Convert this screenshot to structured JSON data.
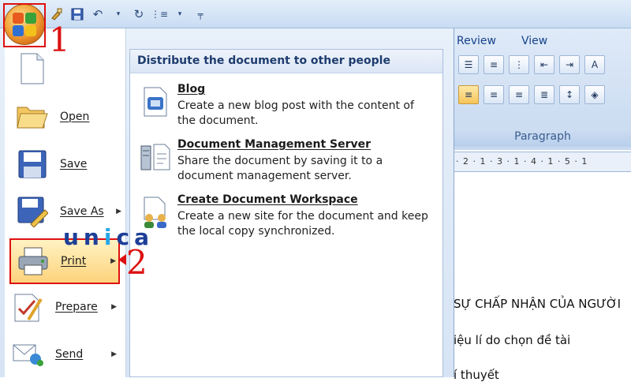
{
  "ribbon": {
    "tabs": [
      "Review",
      "View"
    ],
    "group_label": "Paragraph",
    "ruler_text": "· 2 · 1 · 3 · 1 · 4 · 1 · 5 · 1"
  },
  "document": {
    "lines": [
      "SỰ CHẤP NHẬN CỦA NGƯỜI",
      "iệu lí do chọn đề tài",
      "í thuyết"
    ]
  },
  "office_menu": {
    "items": [
      {
        "label": "",
        "icon": "new-document-icon",
        "arrow": false
      },
      {
        "label": "Open",
        "icon": "open-folder-icon",
        "arrow": false
      },
      {
        "label": "Save",
        "icon": "save-disk-icon",
        "arrow": false
      },
      {
        "label": "Save As",
        "icon": "save-as-icon",
        "arrow": true
      },
      {
        "label": "Print",
        "icon": "printer-icon",
        "arrow": true
      },
      {
        "label": "Prepare",
        "icon": "prepare-icon",
        "arrow": true
      },
      {
        "label": "Send",
        "icon": "send-icon",
        "arrow": true
      }
    ]
  },
  "submenu": {
    "header": "Distribute the document to other people",
    "items": [
      {
        "title": "Blog",
        "description": "Create a new blog post with the content of the document.",
        "icon": "blog-icon"
      },
      {
        "title": "Document Management Server",
        "description": "Share the document by saving it to a document management server.",
        "icon": "server-icon"
      },
      {
        "title": "Create Document Workspace",
        "description": "Create a new site for the document and keep the local copy synchronized.",
        "icon": "workspace-icon"
      }
    ]
  },
  "annotations": {
    "step1": "1",
    "step2": "2"
  },
  "watermark": {
    "part1": "un",
    "part2": "i",
    "part3": "ca"
  }
}
